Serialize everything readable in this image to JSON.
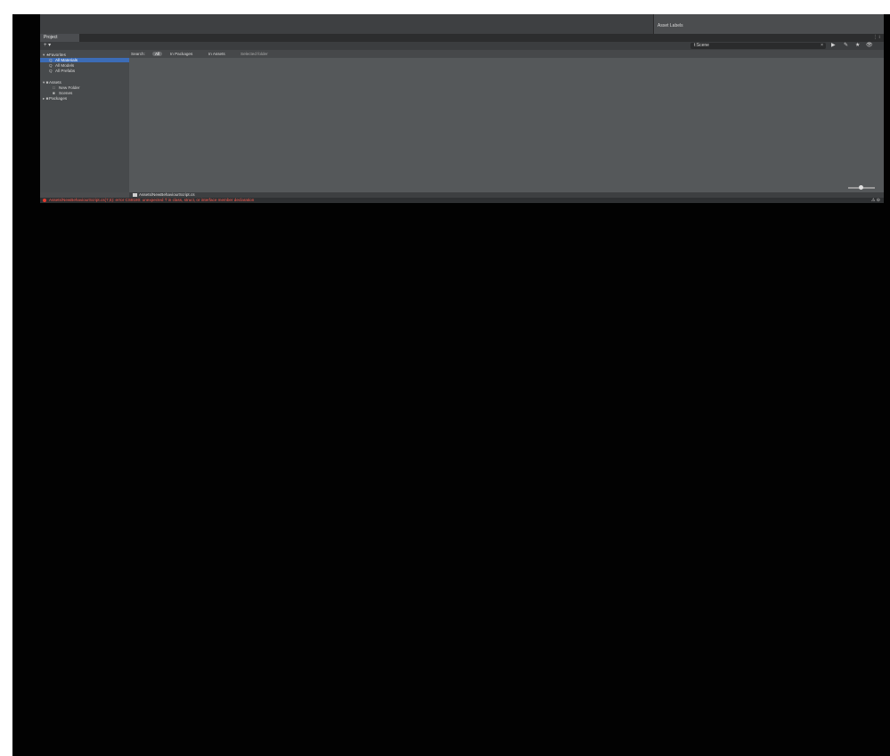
{
  "window": {
    "asset_labels": "Asset Labels",
    "tab_title": "Project",
    "tab_icons": "⋮ ⁝"
  },
  "toolbar": {
    "add_label": "+ ▾",
    "search_value": "t:Scene",
    "search_clear": "×",
    "icons": [
      "▶",
      "✎",
      "★",
      "👁"
    ]
  },
  "sidebar": {
    "items": [
      {
        "label": "Favorites",
        "glyph": "▾ ★"
      },
      {
        "label": "All Materials",
        "glyph": "Q"
      },
      {
        "label": "All Models",
        "glyph": "Q"
      },
      {
        "label": "All Prefabs",
        "glyph": "Q"
      },
      {
        "label": "Assets",
        "glyph": "▾ ■"
      },
      {
        "label": "New Folder",
        "glyph": "□"
      },
      {
        "label": "Scenes",
        "glyph": "■"
      },
      {
        "label": "Packages",
        "glyph": "▸ ■"
      }
    ]
  },
  "filter_bar": {
    "search_label": "Search:",
    "all_label": "All",
    "in_packages_label": "In Packages",
    "in_assets_label": "In Assets",
    "selected_folder_label": "Selected folder"
  },
  "pathbar": {
    "path": "Assets/NewBehaviourScript.cs"
  },
  "status": {
    "error_message": "Assets/NewBehaviourScript.cs(7,5): error CS8180: unexpected 'l' in class, struct, or interface member declaration",
    "right_icons": "⚠ ⊝"
  },
  "colors": {
    "selection": "#3c6cb6",
    "error": "#ff5a4e"
  }
}
